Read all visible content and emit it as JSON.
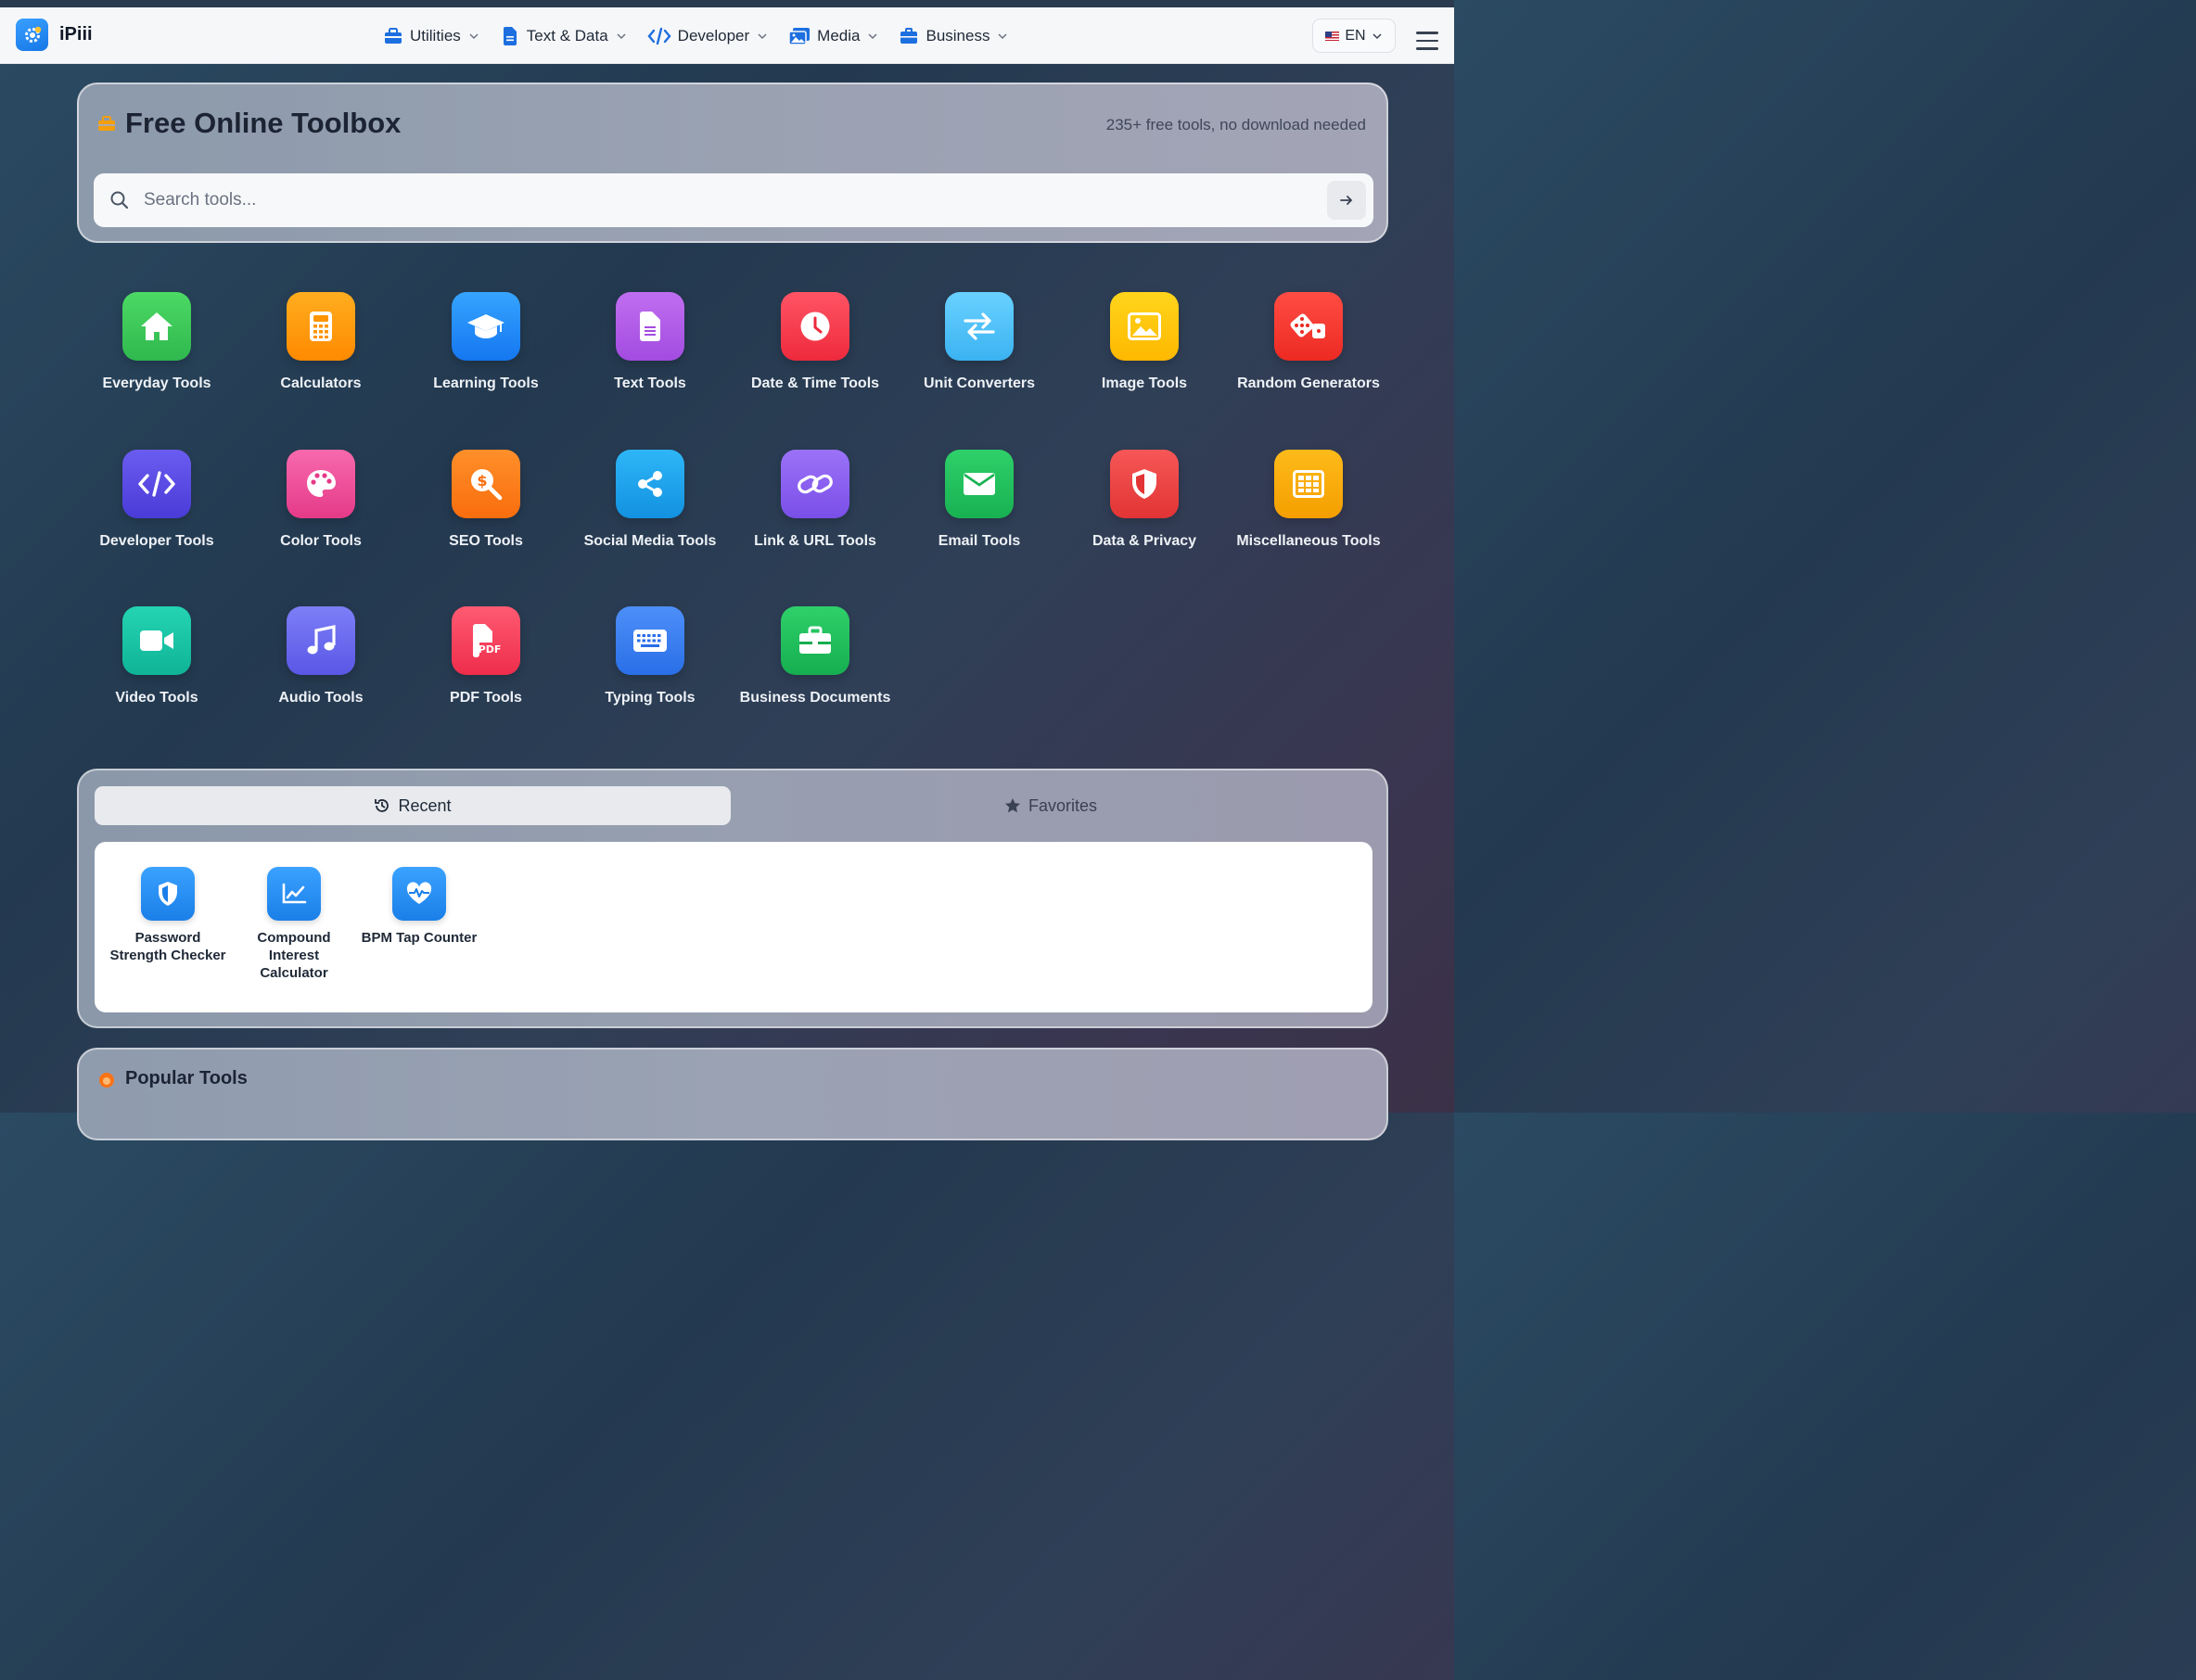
{
  "brand": {
    "name": "iPiii"
  },
  "nav": {
    "items": [
      {
        "label": "Utilities",
        "icon": "toolbox-icon"
      },
      {
        "label": "Text & Data",
        "icon": "file-text-icon"
      },
      {
        "label": "Developer",
        "icon": "code-icon"
      },
      {
        "label": "Media",
        "icon": "images-icon"
      },
      {
        "label": "Business",
        "icon": "briefcase-icon"
      }
    ],
    "language": "EN"
  },
  "hero": {
    "title": "Free Online Toolbox",
    "subtitle": "235+ free tools, no download needed",
    "search_placeholder": "Search tools..."
  },
  "categories": [
    {
      "label": "Everyday Tools",
      "icon": "home-icon",
      "color": "#34c759"
    },
    {
      "label": "Calculators",
      "icon": "calculator-icon",
      "color": "#ff9500"
    },
    {
      "label": "Learning Tools",
      "icon": "graduation-cap-icon",
      "color": "#1c8cff"
    },
    {
      "label": "Text Tools",
      "icon": "document-icon",
      "color": "#b05ce8"
    },
    {
      "label": "Date & Time Tools",
      "icon": "clock-icon",
      "color": "#ff3b4e"
    },
    {
      "label": "Unit Converters",
      "icon": "arrows-exchange-icon",
      "color": "#4fc3f7"
    },
    {
      "label": "Image Tools",
      "icon": "image-icon",
      "color": "#ffcc00"
    },
    {
      "label": "Random Generators",
      "icon": "dice-icon",
      "color": "#ff3b30"
    },
    {
      "label": "Developer Tools",
      "icon": "code-icon",
      "color": "#5b4de0"
    },
    {
      "label": "Color Tools",
      "icon": "palette-icon",
      "color": "#f0509a"
    },
    {
      "label": "SEO Tools",
      "icon": "search-dollar-icon",
      "color": "#ff7a1a"
    },
    {
      "label": "Social Media Tools",
      "icon": "share-icon",
      "color": "#1ea7f0"
    },
    {
      "label": "Link & URL Tools",
      "icon": "link-icon",
      "color": "#8b5cf6"
    },
    {
      "label": "Email Tools",
      "icon": "envelope-icon",
      "color": "#22c55e"
    },
    {
      "label": "Data & Privacy",
      "icon": "shield-icon",
      "color": "#ef4444"
    },
    {
      "label": "Miscellaneous Tools",
      "icon": "grid-icon",
      "color": "#f5b301"
    },
    {
      "label": "Video Tools",
      "icon": "video-camera-icon",
      "color": "#14c7a5"
    },
    {
      "label": "Audio Tools",
      "icon": "music-note-icon",
      "color": "#6366f1"
    },
    {
      "label": "PDF Tools",
      "icon": "pdf-file-icon",
      "color": "#f43f5e"
    },
    {
      "label": "Typing Tools",
      "icon": "keyboard-icon",
      "color": "#3b82f6"
    },
    {
      "label": "Business Documents",
      "icon": "briefcase-icon",
      "color": "#22c55e"
    }
  ],
  "recent_panel": {
    "tab_recent": "Recent",
    "tab_favorites": "Favorites",
    "items": [
      {
        "label": "Password Strength Checker",
        "icon": "shield-icon"
      },
      {
        "label": "Compound Interest Calculator",
        "icon": "line-chart-icon"
      },
      {
        "label": "BPM Tap Counter",
        "icon": "heartbeat-icon"
      }
    ]
  },
  "popular": {
    "title": "Popular Tools"
  }
}
